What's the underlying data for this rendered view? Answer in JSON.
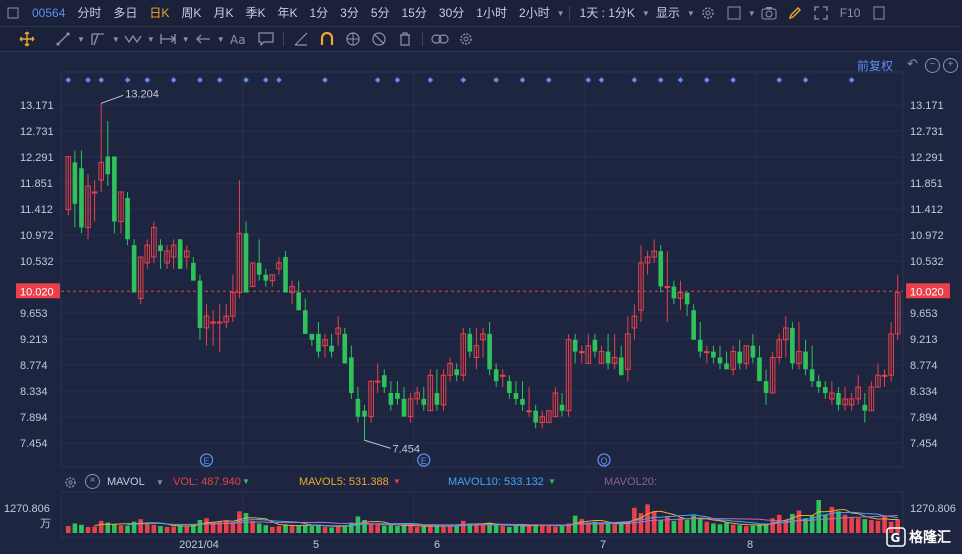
{
  "toolbar_top": {
    "code": "00564",
    "periods": [
      "分时",
      "多日",
      "日K",
      "周K",
      "月K",
      "季K",
      "年K",
      "1分",
      "3分",
      "5分",
      "15分",
      "30分",
      "1小时",
      "2小时"
    ],
    "active_period": "日K",
    "interval_select": "1天 : 1分K",
    "display_select": "显示",
    "f10": "F10"
  },
  "chart": {
    "restore_label": "前复权",
    "price_ticks": [
      "13.171",
      "12.731",
      "12.291",
      "11.851",
      "11.412",
      "10.972",
      "10.532",
      "10.020",
      "9.653",
      "9.213",
      "8.774",
      "8.334",
      "7.894",
      "7.454"
    ],
    "current_price": "10.020",
    "high_label": "13.204",
    "low_label": "7.454",
    "event_markers": [
      "E",
      "E",
      "Q"
    ],
    "x_labels": [
      "2021/04",
      "5",
      "6",
      "7",
      "8"
    ]
  },
  "volume": {
    "indicator": "MAVOL",
    "vol": "VOL: 487.940",
    "ma5": "MAVOL5: 531.388",
    "ma10": "MAVOL10: 533.132",
    "ma20": "MAVOL20:",
    "max_label": "1270.806",
    "unit": "万"
  },
  "colors": {
    "background": "#1d2540",
    "up": "#e8414a",
    "down": "#2fc25b",
    "current_price": "#e8414a",
    "accent": "#f0a830",
    "link": "#5b8dee",
    "ma5": "#f0a830",
    "ma10": "#3fa9f5",
    "ma20": "#b96fbf"
  },
  "chart_data": {
    "type": "candlestick",
    "symbol": "00564",
    "ylim": [
      7.454,
      13.171
    ],
    "candles": [
      {
        "o": 11.4,
        "h": 12.3,
        "l": 11.3,
        "c": 12.3
      },
      {
        "o": 12.2,
        "h": 12.4,
        "l": 11.1,
        "c": 11.5
      },
      {
        "o": 12.1,
        "h": 12.4,
        "l": 11.0,
        "c": 11.1
      },
      {
        "o": 11.1,
        "h": 12.0,
        "l": 10.9,
        "c": 11.8
      },
      {
        "o": 11.7,
        "h": 11.9,
        "l": 11.2,
        "c": 11.7
      },
      {
        "o": 11.9,
        "h": 13.2,
        "l": 11.7,
        "c": 12.2
      },
      {
        "o": 12.3,
        "h": 12.9,
        "l": 11.8,
        "c": 12.0
      },
      {
        "o": 12.3,
        "h": 12.3,
        "l": 11.0,
        "c": 11.2
      },
      {
        "o": 11.2,
        "h": 11.7,
        "l": 11.0,
        "c": 11.7
      },
      {
        "o": 11.6,
        "h": 11.7,
        "l": 10.8,
        "c": 10.9
      },
      {
        "o": 10.8,
        "h": 10.9,
        "l": 10.0,
        "c": 10.0
      },
      {
        "o": 9.9,
        "h": 10.6,
        "l": 9.8,
        "c": 10.6
      },
      {
        "o": 10.5,
        "h": 10.9,
        "l": 10.4,
        "c": 10.8
      },
      {
        "o": 10.6,
        "h": 11.2,
        "l": 10.5,
        "c": 11.1
      },
      {
        "o": 10.8,
        "h": 10.9,
        "l": 10.4,
        "c": 10.7
      },
      {
        "o": 10.5,
        "h": 10.8,
        "l": 10.4,
        "c": 10.7
      },
      {
        "o": 10.6,
        "h": 10.9,
        "l": 10.4,
        "c": 10.8
      },
      {
        "o": 10.9,
        "h": 10.9,
        "l": 10.4,
        "c": 10.4
      },
      {
        "o": 10.6,
        "h": 10.8,
        "l": 10.4,
        "c": 10.7
      },
      {
        "o": 10.5,
        "h": 10.6,
        "l": 10.2,
        "c": 10.2
      },
      {
        "o": 10.2,
        "h": 10.3,
        "l": 9.2,
        "c": 9.4
      },
      {
        "o": 9.4,
        "h": 9.8,
        "l": 9.1,
        "c": 9.6
      },
      {
        "o": 9.5,
        "h": 9.7,
        "l": 9.1,
        "c": 9.5
      },
      {
        "o": 9.5,
        "h": 9.8,
        "l": 9.0,
        "c": 9.5
      },
      {
        "o": 9.5,
        "h": 9.8,
        "l": 9.4,
        "c": 9.6
      },
      {
        "o": 9.6,
        "h": 10.3,
        "l": 9.5,
        "c": 10.0
      },
      {
        "o": 10.0,
        "h": 11.9,
        "l": 9.9,
        "c": 11.0
      },
      {
        "o": 11.0,
        "h": 11.2,
        "l": 10.0,
        "c": 10.0
      },
      {
        "o": 10.1,
        "h": 10.5,
        "l": 10.1,
        "c": 10.5
      },
      {
        "o": 10.5,
        "h": 10.9,
        "l": 10.2,
        "c": 10.3
      },
      {
        "o": 10.3,
        "h": 10.4,
        "l": 10.1,
        "c": 10.2
      },
      {
        "o": 10.2,
        "h": 10.3,
        "l": 10.1,
        "c": 10.3
      },
      {
        "o": 10.4,
        "h": 10.6,
        "l": 10.3,
        "c": 10.5
      },
      {
        "o": 10.6,
        "h": 10.7,
        "l": 10.0,
        "c": 10.0
      },
      {
        "o": 10.0,
        "h": 10.2,
        "l": 9.8,
        "c": 10.1
      },
      {
        "o": 10.0,
        "h": 10.2,
        "l": 9.7,
        "c": 9.7
      },
      {
        "o": 9.7,
        "h": 9.9,
        "l": 9.3,
        "c": 9.3
      },
      {
        "o": 9.3,
        "h": 9.3,
        "l": 9.1,
        "c": 9.2
      },
      {
        "o": 9.3,
        "h": 9.5,
        "l": 8.9,
        "c": 9.0
      },
      {
        "o": 9.1,
        "h": 9.3,
        "l": 8.9,
        "c": 9.2
      },
      {
        "o": 9.1,
        "h": 9.3,
        "l": 8.9,
        "c": 9.0
      },
      {
        "o": 9.3,
        "h": 9.6,
        "l": 9.1,
        "c": 9.4
      },
      {
        "o": 9.3,
        "h": 9.4,
        "l": 8.8,
        "c": 8.8
      },
      {
        "o": 8.9,
        "h": 9.1,
        "l": 8.2,
        "c": 8.3
      },
      {
        "o": 8.2,
        "h": 8.4,
        "l": 7.8,
        "c": 7.9
      },
      {
        "o": 8.0,
        "h": 8.1,
        "l": 7.5,
        "c": 7.9
      },
      {
        "o": 7.9,
        "h": 8.5,
        "l": 7.8,
        "c": 8.5
      },
      {
        "o": 8.5,
        "h": 8.8,
        "l": 8.3,
        "c": 8.5
      },
      {
        "o": 8.6,
        "h": 8.7,
        "l": 8.3,
        "c": 8.4
      },
      {
        "o": 8.3,
        "h": 8.5,
        "l": 8.0,
        "c": 8.1
      },
      {
        "o": 8.3,
        "h": 8.5,
        "l": 8.1,
        "c": 8.2
      },
      {
        "o": 8.2,
        "h": 8.4,
        "l": 7.9,
        "c": 7.9
      },
      {
        "o": 7.9,
        "h": 8.3,
        "l": 7.8,
        "c": 8.2
      },
      {
        "o": 8.2,
        "h": 8.4,
        "l": 8.1,
        "c": 8.3
      },
      {
        "o": 8.2,
        "h": 8.4,
        "l": 8.0,
        "c": 8.1
      },
      {
        "o": 8.0,
        "h": 8.7,
        "l": 8.0,
        "c": 8.6
      },
      {
        "o": 8.3,
        "h": 8.7,
        "l": 8.0,
        "c": 8.1
      },
      {
        "o": 8.1,
        "h": 8.7,
        "l": 8.0,
        "c": 8.6
      },
      {
        "o": 8.6,
        "h": 8.9,
        "l": 8.5,
        "c": 8.8
      },
      {
        "o": 8.7,
        "h": 8.8,
        "l": 8.5,
        "c": 8.6
      },
      {
        "o": 8.6,
        "h": 9.4,
        "l": 8.5,
        "c": 9.3
      },
      {
        "o": 9.3,
        "h": 9.4,
        "l": 8.9,
        "c": 9.0
      },
      {
        "o": 8.9,
        "h": 9.4,
        "l": 8.7,
        "c": 9.1
      },
      {
        "o": 9.2,
        "h": 9.4,
        "l": 8.9,
        "c": 9.3
      },
      {
        "o": 9.3,
        "h": 9.5,
        "l": 8.6,
        "c": 8.7
      },
      {
        "o": 8.7,
        "h": 8.8,
        "l": 8.4,
        "c": 8.5
      },
      {
        "o": 8.6,
        "h": 8.7,
        "l": 8.4,
        "c": 8.6
      },
      {
        "o": 8.5,
        "h": 8.6,
        "l": 8.2,
        "c": 8.3
      },
      {
        "o": 8.3,
        "h": 8.5,
        "l": 8.1,
        "c": 8.2
      },
      {
        "o": 8.2,
        "h": 8.5,
        "l": 8.0,
        "c": 8.1
      },
      {
        "o": 8.0,
        "h": 8.4,
        "l": 7.9,
        "c": 8.0
      },
      {
        "o": 8.0,
        "h": 8.1,
        "l": 7.7,
        "c": 7.8
      },
      {
        "o": 7.8,
        "h": 8.0,
        "l": 7.7,
        "c": 7.9
      },
      {
        "o": 7.8,
        "h": 8.0,
        "l": 7.8,
        "c": 8.0
      },
      {
        "o": 7.9,
        "h": 8.4,
        "l": 7.9,
        "c": 8.3
      },
      {
        "o": 8.1,
        "h": 8.3,
        "l": 7.9,
        "c": 8.0
      },
      {
        "o": 8.0,
        "h": 9.3,
        "l": 7.9,
        "c": 9.2
      },
      {
        "o": 9.2,
        "h": 9.3,
        "l": 8.8,
        "c": 9.0
      },
      {
        "o": 9.0,
        "h": 9.1,
        "l": 8.8,
        "c": 9.0
      },
      {
        "o": 8.8,
        "h": 9.3,
        "l": 8.8,
        "c": 9.1
      },
      {
        "o": 9.2,
        "h": 9.3,
        "l": 8.9,
        "c": 9.0
      },
      {
        "o": 8.8,
        "h": 9.1,
        "l": 8.8,
        "c": 9.0
      },
      {
        "o": 9.0,
        "h": 9.3,
        "l": 8.7,
        "c": 8.8
      },
      {
        "o": 8.8,
        "h": 9.3,
        "l": 8.7,
        "c": 8.9
      },
      {
        "o": 8.9,
        "h": 9.1,
        "l": 8.6,
        "c": 8.6
      },
      {
        "o": 8.7,
        "h": 9.6,
        "l": 8.5,
        "c": 9.3
      },
      {
        "o": 9.4,
        "h": 9.8,
        "l": 9.2,
        "c": 9.6
      },
      {
        "o": 9.7,
        "h": 10.8,
        "l": 9.5,
        "c": 10.5
      },
      {
        "o": 10.5,
        "h": 10.7,
        "l": 10.3,
        "c": 10.6
      },
      {
        "o": 10.6,
        "h": 10.9,
        "l": 10.5,
        "c": 10.7
      },
      {
        "o": 10.7,
        "h": 10.8,
        "l": 10.0,
        "c": 10.1
      },
      {
        "o": 10.1,
        "h": 10.7,
        "l": 9.5,
        "c": 10.1
      },
      {
        "o": 10.1,
        "h": 10.2,
        "l": 9.8,
        "c": 9.9
      },
      {
        "o": 9.9,
        "h": 10.2,
        "l": 9.7,
        "c": 10.0
      },
      {
        "o": 10.0,
        "h": 10.0,
        "l": 9.6,
        "c": 9.8
      },
      {
        "o": 9.7,
        "h": 9.8,
        "l": 9.2,
        "c": 9.2
      },
      {
        "o": 9.2,
        "h": 9.5,
        "l": 8.9,
        "c": 9.0
      },
      {
        "o": 9.0,
        "h": 9.1,
        "l": 8.8,
        "c": 9.0
      },
      {
        "o": 9.0,
        "h": 9.1,
        "l": 8.8,
        "c": 8.9
      },
      {
        "o": 8.9,
        "h": 9.1,
        "l": 8.7,
        "c": 8.8
      },
      {
        "o": 8.8,
        "h": 9.0,
        "l": 8.7,
        "c": 8.7
      },
      {
        "o": 8.7,
        "h": 9.1,
        "l": 8.6,
        "c": 9.0
      },
      {
        "o": 9.0,
        "h": 9.2,
        "l": 8.7,
        "c": 8.8
      },
      {
        "o": 8.8,
        "h": 9.1,
        "l": 8.7,
        "c": 9.1
      },
      {
        "o": 9.1,
        "h": 9.3,
        "l": 8.8,
        "c": 8.9
      },
      {
        "o": 8.9,
        "h": 9.1,
        "l": 8.5,
        "c": 8.5
      },
      {
        "o": 8.5,
        "h": 8.7,
        "l": 8.1,
        "c": 8.3
      },
      {
        "o": 8.3,
        "h": 9.0,
        "l": 8.3,
        "c": 8.9
      },
      {
        "o": 8.9,
        "h": 9.3,
        "l": 8.8,
        "c": 9.2
      },
      {
        "o": 9.2,
        "h": 9.6,
        "l": 8.9,
        "c": 9.4
      },
      {
        "o": 9.4,
        "h": 9.5,
        "l": 8.7,
        "c": 8.8
      },
      {
        "o": 8.8,
        "h": 9.5,
        "l": 8.7,
        "c": 9.0
      },
      {
        "o": 9.0,
        "h": 9.2,
        "l": 8.6,
        "c": 8.7
      },
      {
        "o": 8.7,
        "h": 9.1,
        "l": 8.4,
        "c": 8.5
      },
      {
        "o": 8.5,
        "h": 8.6,
        "l": 8.3,
        "c": 8.4
      },
      {
        "o": 8.4,
        "h": 8.5,
        "l": 8.2,
        "c": 8.3
      },
      {
        "o": 8.2,
        "h": 8.5,
        "l": 8.1,
        "c": 8.3
      },
      {
        "o": 8.3,
        "h": 8.4,
        "l": 8.0,
        "c": 8.1
      },
      {
        "o": 8.1,
        "h": 8.4,
        "l": 8.0,
        "c": 8.2
      },
      {
        "o": 8.1,
        "h": 8.3,
        "l": 8.0,
        "c": 8.2
      },
      {
        "o": 8.2,
        "h": 8.6,
        "l": 8.1,
        "c": 8.4
      },
      {
        "o": 8.1,
        "h": 8.3,
        "l": 7.8,
        "c": 8.0
      },
      {
        "o": 8.0,
        "h": 8.5,
        "l": 8.0,
        "c": 8.4
      },
      {
        "o": 8.4,
        "h": 8.8,
        "l": 8.4,
        "c": 8.6
      },
      {
        "o": 8.6,
        "h": 8.7,
        "l": 8.4,
        "c": 8.6
      },
      {
        "o": 8.6,
        "h": 9.5,
        "l": 8.5,
        "c": 9.3
      },
      {
        "o": 9.3,
        "h": 10.3,
        "l": 9.2,
        "c": 10.0
      }
    ],
    "volume": [
      80,
      110,
      95,
      70,
      75,
      140,
      120,
      100,
      90,
      85,
      130,
      160,
      110,
      95,
      80,
      70,
      75,
      90,
      85,
      95,
      150,
      170,
      120,
      130,
      140,
      120,
      250,
      230,
      140,
      110,
      90,
      70,
      80,
      100,
      90,
      85,
      90,
      80,
      95,
      70,
      65,
      80,
      85,
      120,
      190,
      150,
      110,
      95,
      85,
      90,
      80,
      85,
      90,
      70,
      75,
      80,
      90,
      70,
      95,
      85,
      140,
      110,
      95,
      100,
      120,
      95,
      80,
      70,
      85,
      90,
      95,
      100,
      85,
      80,
      75,
      90,
      110,
      200,
      160,
      120,
      130,
      110,
      115,
      100,
      120,
      130,
      290,
      230,
      330,
      250,
      150,
      190,
      140,
      170,
      150,
      200,
      160,
      130,
      110,
      100,
      120,
      95,
      90,
      80,
      85,
      100,
      110,
      170,
      210,
      150,
      220,
      260,
      170,
      200,
      380,
      210,
      300,
      250,
      210,
      180,
      170,
      160,
      150,
      140,
      200,
      130,
      160,
      120,
      140,
      110
    ],
    "x_labels": [
      "2021/04",
      "5",
      "6",
      "7",
      "8"
    ],
    "high_label": "13.204",
    "low_label": "7.454",
    "current_price": "10.020"
  }
}
